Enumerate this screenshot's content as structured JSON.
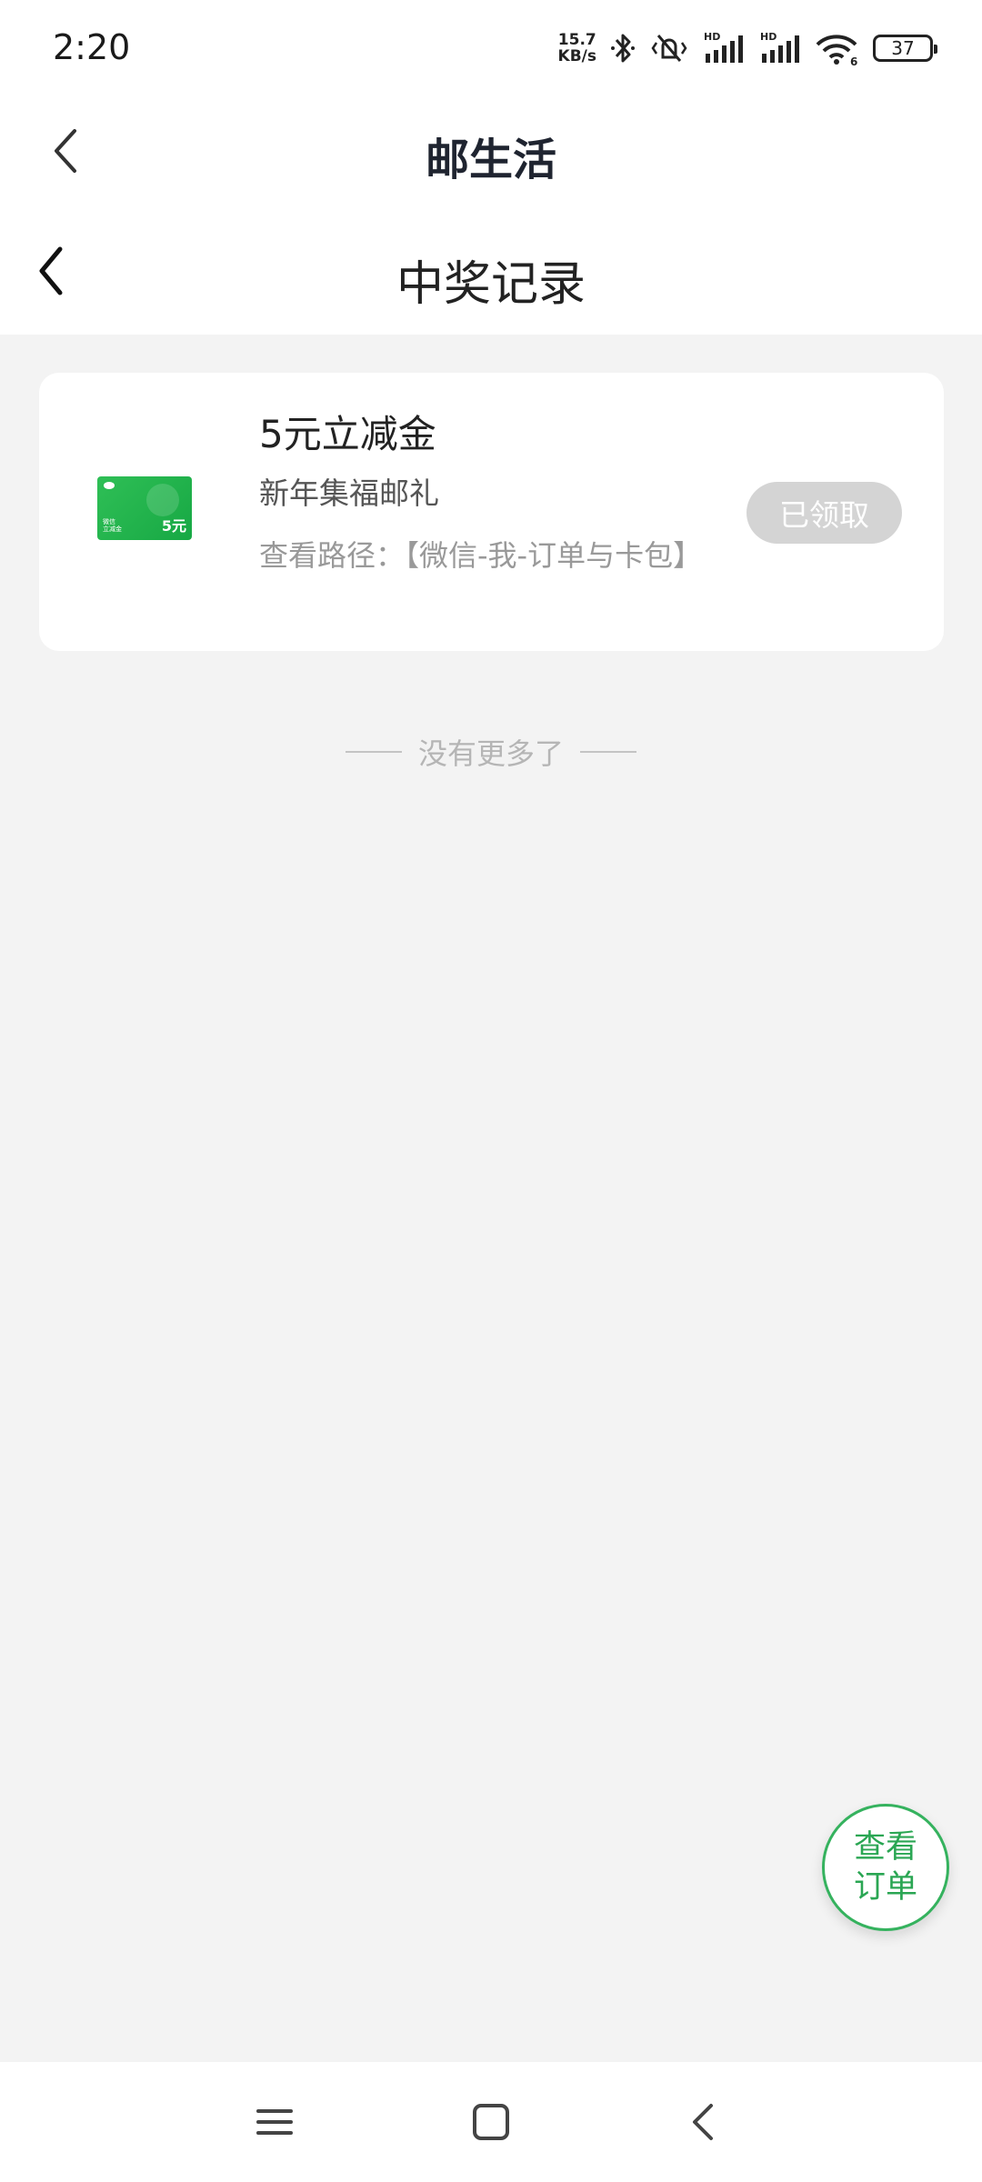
{
  "status_bar": {
    "time": "2:20",
    "net_speed_value": "15.7",
    "net_speed_unit": "KB/s",
    "hd_label": "HD",
    "wifi_label": "6",
    "battery": "37",
    "icons": [
      "bluetooth-icon",
      "mute-vibrate-icon",
      "signal-icon",
      "signal-icon",
      "wifi-icon",
      "battery-icon"
    ]
  },
  "host_header": {
    "title": "邮生活"
  },
  "page_header": {
    "title": "中奖记录"
  },
  "prize_card": {
    "title": "5元立减金",
    "source": "新年集福邮礼",
    "path": "查看路径：【微信-我-订单与卡包】",
    "button_label": "已领取",
    "voucher": {
      "amount": "5元",
      "text_line1": "微信",
      "text_line2": "立减金",
      "color": "#1fb04b"
    }
  },
  "list_end": {
    "text": "没有更多了"
  },
  "floating_button": {
    "label": "查看订单",
    "color": "#2aa653"
  },
  "nav_bar": {
    "icons": [
      "menu-icon",
      "home-icon",
      "back-icon"
    ]
  },
  "colors": {
    "background": "#f3f3f3",
    "card": "#ffffff",
    "accent_green": "#2aa653",
    "disabled_button": "#d4d4d4"
  }
}
